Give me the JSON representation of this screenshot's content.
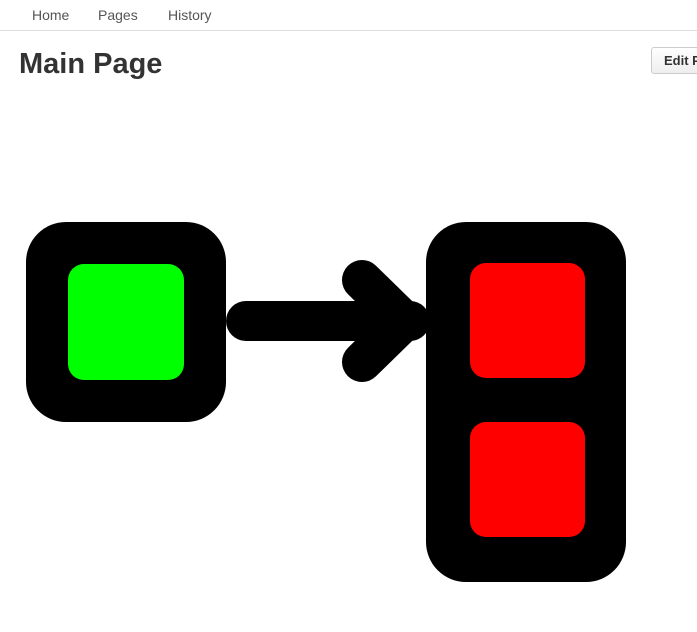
{
  "nav": {
    "home": "Home",
    "pages": "Pages",
    "history": "History"
  },
  "page": {
    "title": "Main Page",
    "edit_button": "Edit P"
  },
  "diagram": {
    "source_inner_color": "#00ff00",
    "target_inner_color": "#ff0000",
    "frame_color": "#000000",
    "arrow_color": "#000000"
  }
}
